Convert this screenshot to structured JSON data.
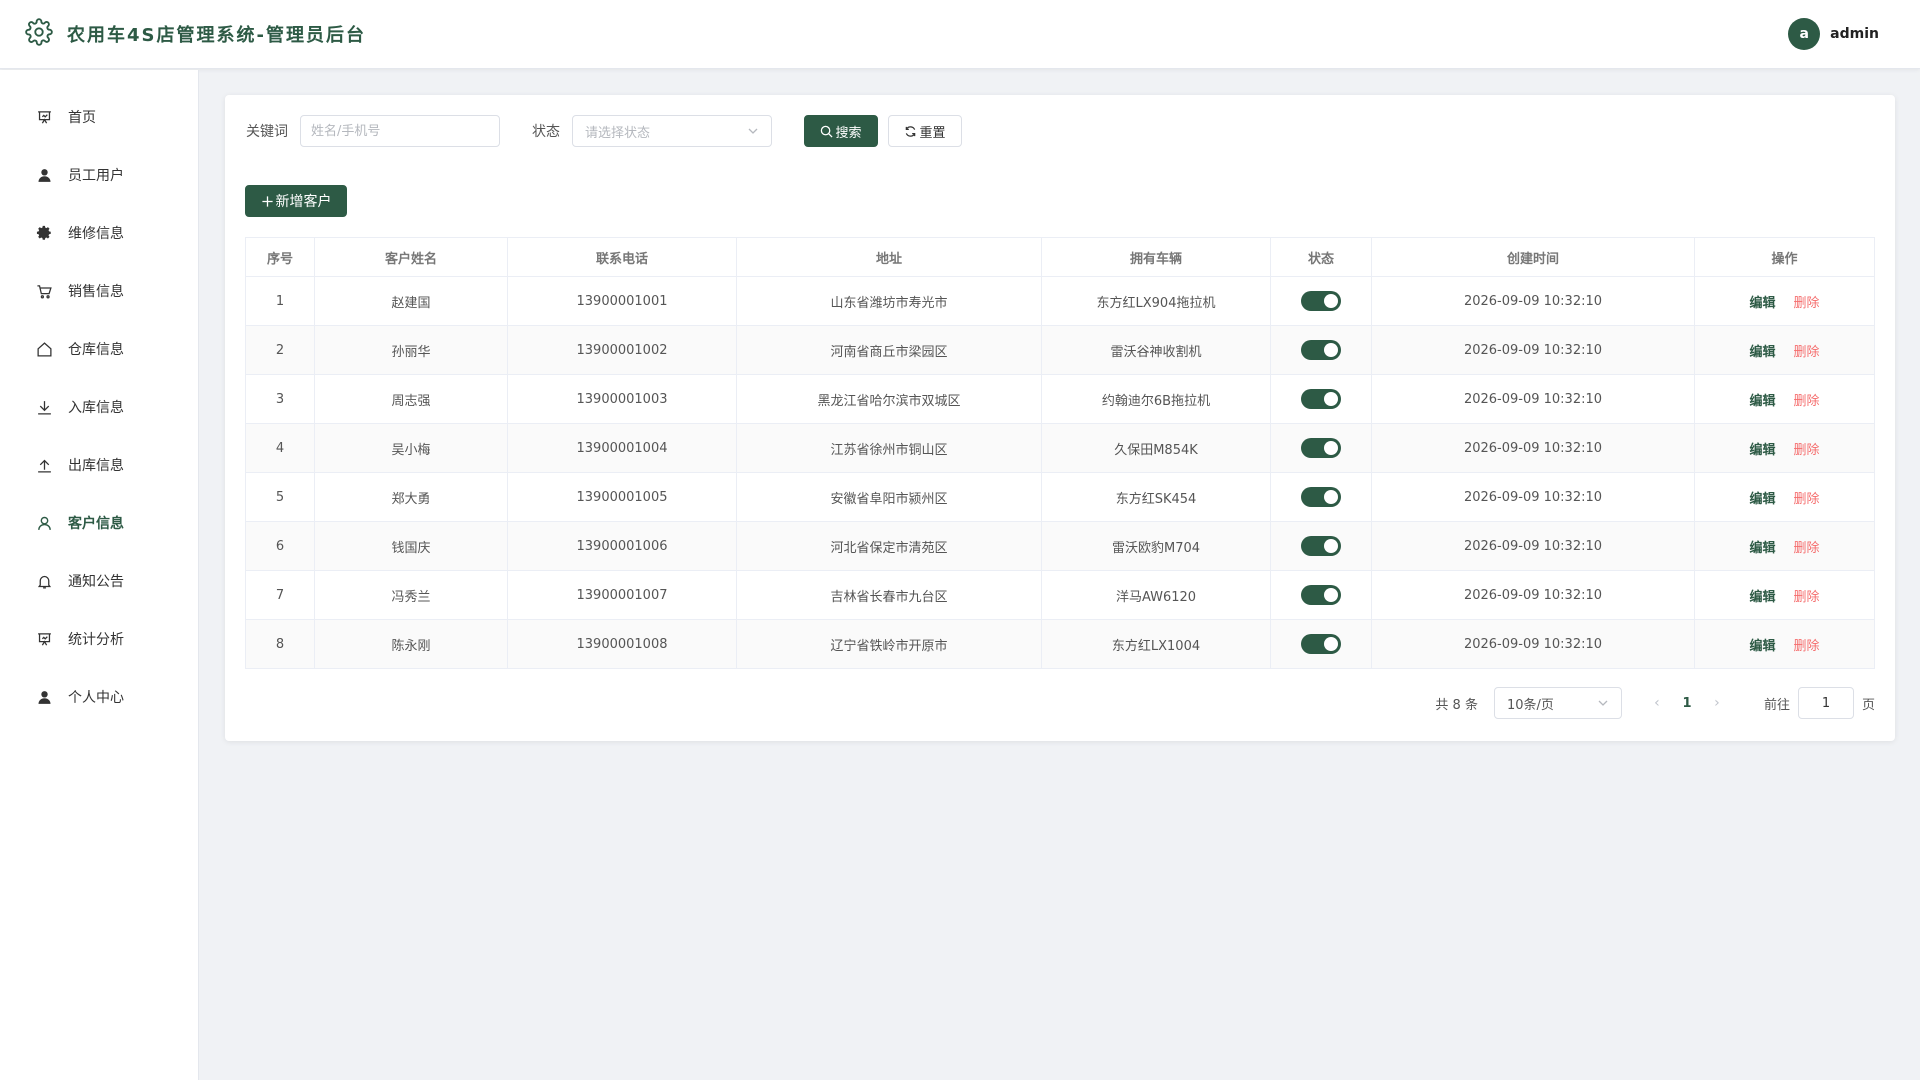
{
  "header": {
    "title": "农用车4S店管理系统-管理员后台",
    "avatar_letter": "a",
    "username": "admin",
    "logo_icon": "gear-icon"
  },
  "sidebar": {
    "items": [
      {
        "label": "首页",
        "icon": "presentation-icon",
        "active": false
      },
      {
        "label": "员工用户",
        "icon": "user-solid-icon",
        "active": false
      },
      {
        "label": "维修信息",
        "icon": "gear-icon",
        "active": false
      },
      {
        "label": "销售信息",
        "icon": "cart-icon",
        "active": false
      },
      {
        "label": "仓库信息",
        "icon": "house-icon",
        "active": false
      },
      {
        "label": "入库信息",
        "icon": "download-icon",
        "active": false
      },
      {
        "label": "出库信息",
        "icon": "upload-icon",
        "active": false
      },
      {
        "label": "客户信息",
        "icon": "user-outline-icon",
        "active": true
      },
      {
        "label": "通知公告",
        "icon": "bell-icon",
        "active": false
      },
      {
        "label": "统计分析",
        "icon": "data-board-icon",
        "active": false
      },
      {
        "label": "个人中心",
        "icon": "user-solid-icon",
        "active": false
      }
    ]
  },
  "filters": {
    "keyword_label": "关键词",
    "keyword_placeholder": "姓名/手机号",
    "keyword_value": "",
    "status_label": "状态",
    "status_placeholder": "请选择状态",
    "search_label": "搜索",
    "reset_label": "重置"
  },
  "toolbar": {
    "add_label": "新增客户"
  },
  "table": {
    "headers": [
      "序号",
      "客户姓名",
      "联系电话",
      "地址",
      "拥有车辆",
      "状态",
      "创建时间",
      "操作"
    ],
    "edit_label": "编辑",
    "delete_label": "删除",
    "rows": [
      {
        "no": "1",
        "name": "赵建国",
        "phone": "13900001001",
        "address": "山东省潍坊市寿光市",
        "vehicle": "东方红LX904拖拉机",
        "status_on": true,
        "created": "2026-09-09 10:32:10"
      },
      {
        "no": "2",
        "name": "孙丽华",
        "phone": "13900001002",
        "address": "河南省商丘市梁园区",
        "vehicle": "雷沃谷神收割机",
        "status_on": true,
        "created": "2026-09-09 10:32:10"
      },
      {
        "no": "3",
        "name": "周志强",
        "phone": "13900001003",
        "address": "黑龙江省哈尔滨市双城区",
        "vehicle": "约翰迪尔6B拖拉机",
        "status_on": true,
        "created": "2026-09-09 10:32:10"
      },
      {
        "no": "4",
        "name": "吴小梅",
        "phone": "13900001004",
        "address": "江苏省徐州市铜山区",
        "vehicle": "久保田M854K",
        "status_on": true,
        "created": "2026-09-09 10:32:10"
      },
      {
        "no": "5",
        "name": "郑大勇",
        "phone": "13900001005",
        "address": "安徽省阜阳市颍州区",
        "vehicle": "东方红SK454",
        "status_on": true,
        "created": "2026-09-09 10:32:10"
      },
      {
        "no": "6",
        "name": "钱国庆",
        "phone": "13900001006",
        "address": "河北省保定市清苑区",
        "vehicle": "雷沃欧豹M704",
        "status_on": true,
        "created": "2026-09-09 10:32:10"
      },
      {
        "no": "7",
        "name": "冯秀兰",
        "phone": "13900001007",
        "address": "吉林省长春市九台区",
        "vehicle": "洋马AW6120",
        "status_on": true,
        "created": "2026-09-09 10:32:10"
      },
      {
        "no": "8",
        "name": "陈永刚",
        "phone": "13900001008",
        "address": "辽宁省铁岭市开原市",
        "vehicle": "东方红LX1004",
        "status_on": true,
        "created": "2026-09-09 10:32:10"
      }
    ]
  },
  "pagination": {
    "total_text": "共 8 条",
    "page_size": "10条/页",
    "current_page": "1",
    "goto_label": "前往",
    "goto_value": "1",
    "page_suffix": "页"
  },
  "colors": {
    "primary": "#2d5a45",
    "danger": "#f56c6c"
  }
}
